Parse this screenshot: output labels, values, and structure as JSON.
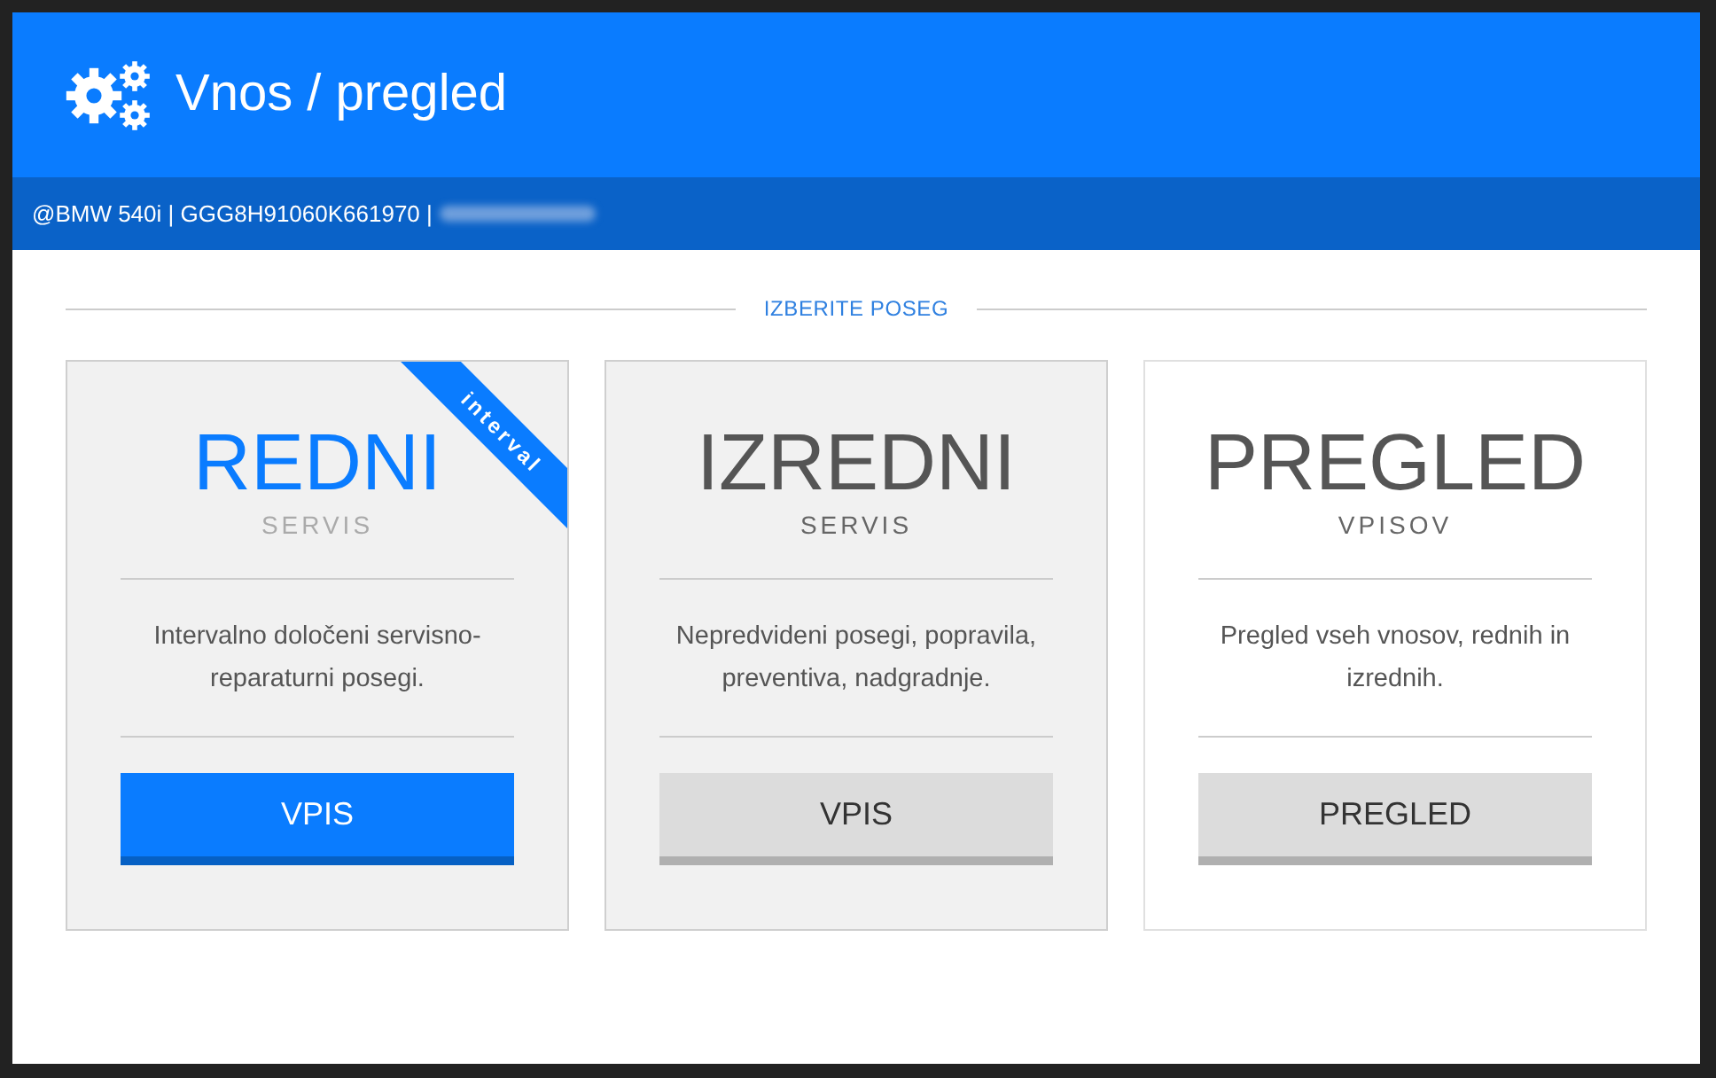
{
  "dialog": {
    "title": "Vnos / pregled",
    "info": "@BMW 540i | GGG8H91060K661970 |",
    "section_label": "IZBERITE POSEG"
  },
  "cards": [
    {
      "title": "REDNI",
      "subtitle": "SERVIS",
      "description": "Intervalno določeni servisno-reparaturni posegi.",
      "button": "VPIS",
      "selected": true,
      "shaded": true,
      "ribbon": "interval"
    },
    {
      "title": "IZREDNI",
      "subtitle": "SERVIS",
      "description": "Nepredvideni posegi, popravila, preventiva, nadgradnje.",
      "button": "VPIS",
      "selected": false,
      "shaded": true
    },
    {
      "title": "PREGLED",
      "subtitle": "VPISOV",
      "description": "Pregled vseh vnosov, rednih in izrednih.",
      "button": "PREGLED",
      "selected": false,
      "shaded": false
    }
  ]
}
